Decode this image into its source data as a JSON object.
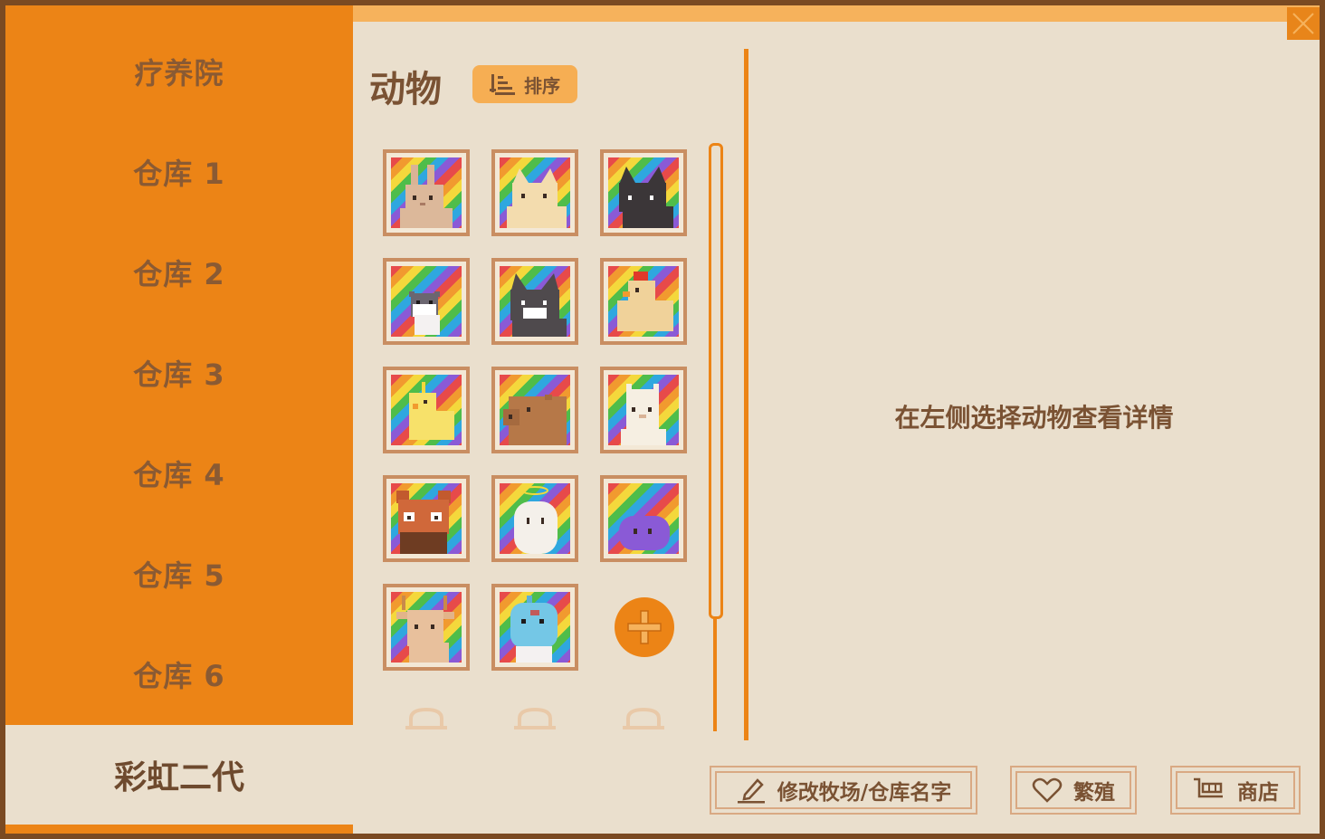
{
  "sidebar": {
    "items": [
      {
        "label": "疗养院"
      },
      {
        "label": "仓库 1"
      },
      {
        "label": "仓库 2"
      },
      {
        "label": "仓库 3"
      },
      {
        "label": "仓库 4"
      },
      {
        "label": "仓库 5"
      },
      {
        "label": "仓库 6"
      }
    ],
    "active": {
      "label": "彩虹二代"
    }
  },
  "animals": {
    "title": "动物",
    "sort_label": "排序",
    "slots": [
      {
        "animal": "rabbit"
      },
      {
        "animal": "cream-cat"
      },
      {
        "animal": "black-cat"
      },
      {
        "animal": "hamster"
      },
      {
        "animal": "gray-cat"
      },
      {
        "animal": "chicken"
      },
      {
        "animal": "yellow-bird"
      },
      {
        "animal": "capybara"
      },
      {
        "animal": "alpaca"
      },
      {
        "animal": "red-panda"
      },
      {
        "animal": "ghost"
      },
      {
        "animal": "purple-slime"
      },
      {
        "animal": "deer"
      },
      {
        "animal": "blue-zombie"
      }
    ],
    "add_icon": "plus-icon"
  },
  "detail": {
    "hint": "在左侧选择动物查看详情"
  },
  "buttons": {
    "rename": "修改牧场/仓库名字",
    "breed": "繁殖",
    "shop": "商店"
  },
  "colors": {
    "accent": "#ec8416",
    "background": "#eadfcd",
    "text": "#7a5233",
    "top_bar": "#f6b25c"
  }
}
